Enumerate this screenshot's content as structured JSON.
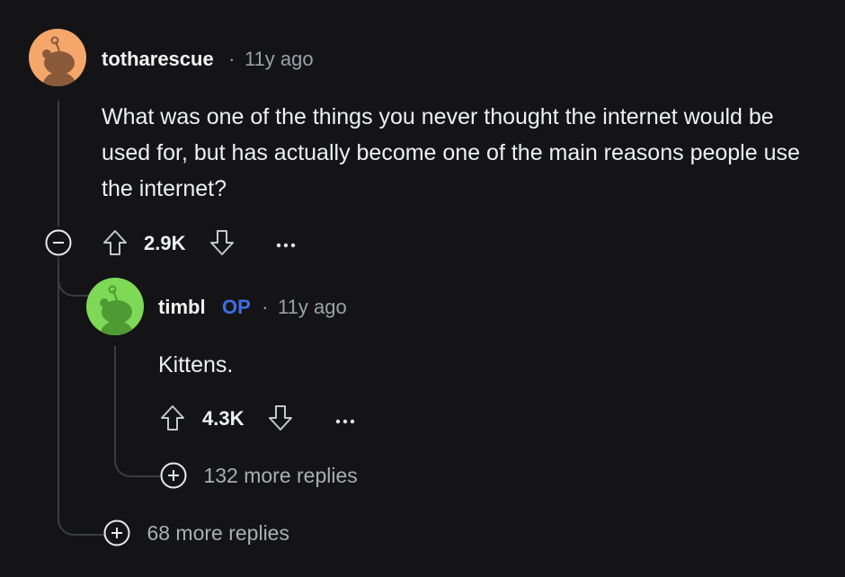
{
  "comments": [
    {
      "username": "totharescue",
      "separator": "·",
      "timestamp": "11y ago",
      "body": "What was one of the things you never thought the internet would be used for, but has actually become one of the main reasons people use the internet?",
      "votes": "2.9K",
      "avatar_color": "#f4a66b"
    },
    {
      "username": "timbl",
      "badge": "OP",
      "separator": "·",
      "timestamp": "11y ago",
      "body": "Kittens.",
      "votes": "4.3K",
      "avatar_color": "#7ed957",
      "more_replies": "132 more replies"
    }
  ],
  "top_more_replies": "68 more replies",
  "icons": {
    "collapse": "minus-circle-icon",
    "upvote": "arrow-up-icon",
    "downvote": "arrow-down-icon",
    "overflow": "more-horizontal-icon",
    "expand": "plus-circle-icon"
  },
  "colors": {
    "background": "#141416",
    "op_badge": "#3d6ee6",
    "thread_line": "#3a3d40"
  }
}
